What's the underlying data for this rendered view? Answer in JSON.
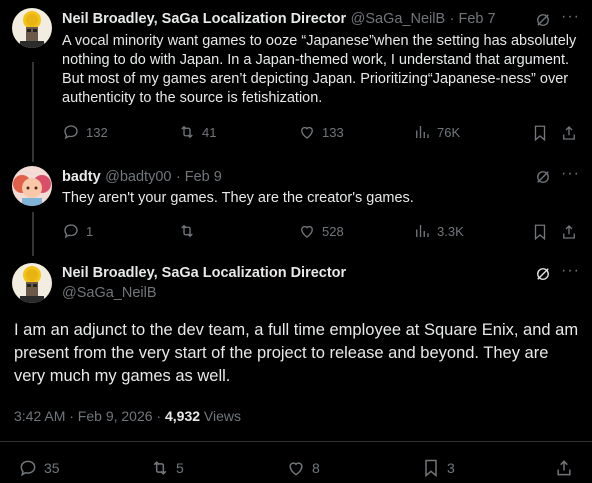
{
  "tweet1": {
    "author": "Neil Broadley, SaGa Localization Director",
    "handle": "@SaGa_NeilB",
    "date": "· Feb 7",
    "text": "A vocal minority want games to ooze “Japanese”when the setting has absolutely nothing to do with Japan. In a Japan-themed work, I understand that argument. But most of my games aren’t depicting Japan. Prioritizing“Japanese-ness” over authenticity to the source is fetishization.",
    "replies": "132",
    "reposts": "41",
    "likes": "133",
    "views": "76K"
  },
  "tweet2": {
    "author": "badty",
    "handle": "@badty00",
    "date": "· Feb 9",
    "text": "They aren't your games. They are the creator's games.",
    "replies": "1",
    "reposts": "",
    "likes": "528",
    "views": "3.3K"
  },
  "tweet3": {
    "author": "Neil Broadley, SaGa Localization Director",
    "handle": "@SaGa_NeilB",
    "text": "I am an adjunct to the dev team, a full time employee at Square Enix, and am present from the very start of the project to release and beyond. They are very much my games as well.",
    "timestamp": "3:42 AM · Feb 9, 2026 ·",
    "views_count": "4,932",
    "views_label": "Views",
    "replies": "35",
    "reposts": "5",
    "likes": "8",
    "bookmarks": "3"
  },
  "colors": {
    "background": "#000000",
    "text": "#e7e9ea",
    "muted": "#71767b",
    "divider": "#2f3336"
  }
}
